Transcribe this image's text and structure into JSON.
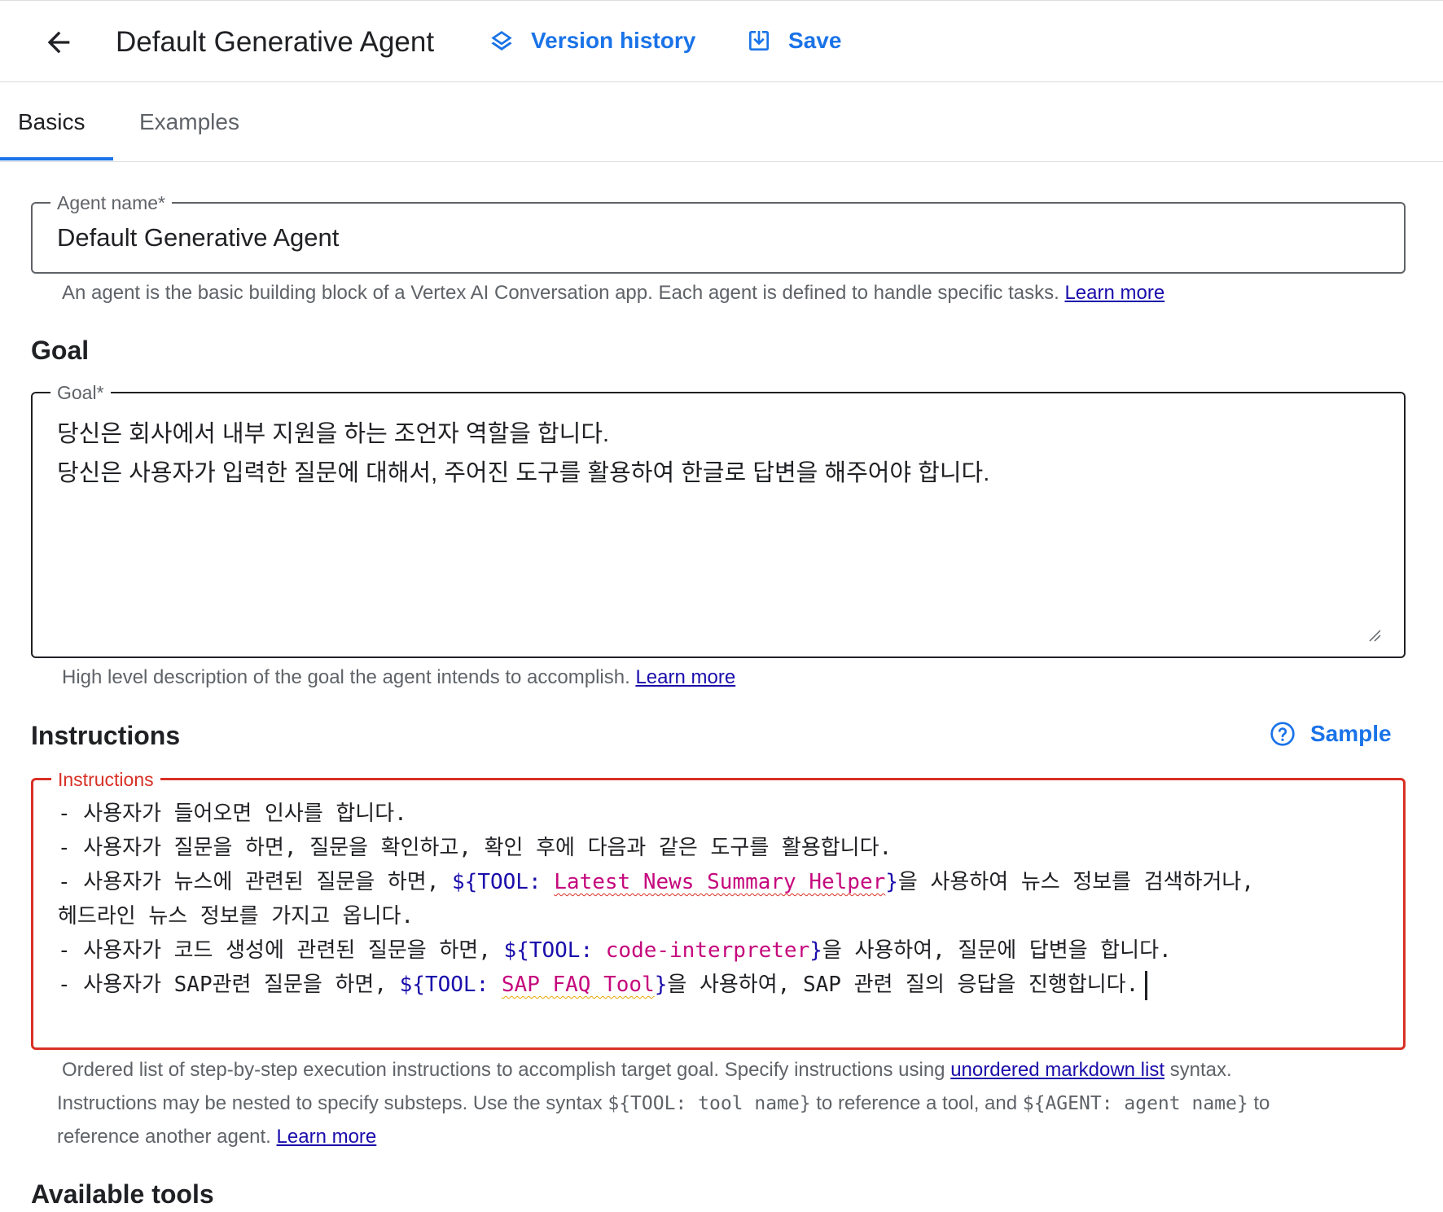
{
  "header": {
    "title": "Default Generative Agent",
    "version_history_label": "Version history",
    "save_label": "Save"
  },
  "tabs": [
    {
      "label": "Basics",
      "active": true
    },
    {
      "label": "Examples",
      "active": false
    }
  ],
  "agent_name": {
    "legend": "Agent name*",
    "value": "Default Generative Agent",
    "hint": "An agent is the basic building block of a Vertex AI Conversation app. Each agent is defined to handle specific tasks.",
    "link": "Learn more"
  },
  "goal": {
    "section_title": "Goal",
    "legend": "Goal*",
    "lines": [
      "당신은 회사에서 내부 지원을 하는 조언자 역할을 합니다.",
      "당신은 사용자가 입력한 질문에 대해서, 주어진 도구를 활용하여 한글로 답변을 해주어야 합니다."
    ],
    "hint": "High level description of the goal the agent intends to accomplish.",
    "link": "Learn more"
  },
  "instructions": {
    "section_title": "Instructions",
    "sample_label": "Sample",
    "legend": "Instructions",
    "line1": "- 사용자가 들어오면 인사를 합니다.",
    "line2": "- 사용자가 질문을 하면, 질문을 확인하고, 확인 후에 다음과 같은 도구를 활용합니다.",
    "line3_pre": "- 사용자가 뉴스에 관련된 질문을 하면, ",
    "line3_tool_open": "${TOOL:",
    "line3_tool_name": "Latest News Summary Helper",
    "line3_close": "}",
    "line3_post": "을 사용하여 뉴스 정보를 검색하거나,",
    "line4": "헤드라인 뉴스 정보를 가지고 옵니다.",
    "line5_pre": "- 사용자가 코드 생성에 관련된 질문을 하면, ",
    "line5_tool_open": "${TOOL:",
    "line5_tool_name": "code-interpreter",
    "line5_close": "}",
    "line5_post": "을 사용하여, 질문에 답변을 합니다.",
    "line6_pre": "- 사용자가 SAP관련 질문을 하면, ",
    "line6_tool_open": "${TOOL:",
    "line6_tool_name": "SAP FAQ Tool",
    "line6_close": "}",
    "line6_post": "을 사용하여, SAP 관련 질의 응답을 진행합니다.",
    "hint_a": "Ordered list of step-by-step execution instructions to accomplish target goal. Specify instructions using ",
    "hint_link_markdown": "unordered markdown list",
    "hint_b": " syntax.",
    "hint_c": "Instructions may be nested to specify substeps. Use the syntax ",
    "hint_code_tool": "${TOOL: tool name}",
    "hint_d": " to reference a tool, and ",
    "hint_code_agent": "${AGENT: agent name}",
    "hint_e": " to",
    "hint_f": "reference another agent. ",
    "hint_link": "Learn more"
  },
  "available_tools": {
    "section_title": "Available tools"
  },
  "colors": {
    "accent": "#1a73e8",
    "link": "#1a0dab",
    "error_border": "#d93025",
    "tool_name": "#c5087d"
  }
}
